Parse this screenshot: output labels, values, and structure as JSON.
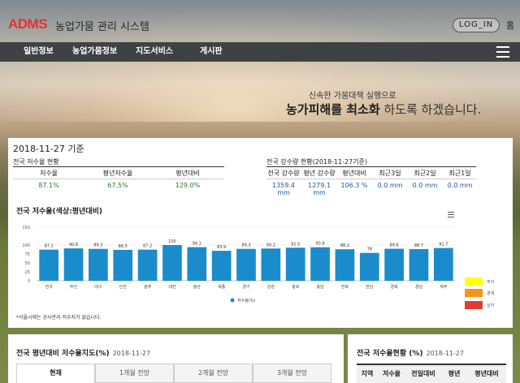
{
  "header": {
    "logo": "ADMS",
    "system_name": "농업가뭄 관리 시스템",
    "login_label": "LOG_IN",
    "home_label": "홈"
  },
  "nav": {
    "items": [
      {
        "label": "일반정보"
      },
      {
        "label": "농업가뭄정보"
      },
      {
        "label": "지도서비스"
      },
      {
        "label": "게시판"
      }
    ]
  },
  "slogan": {
    "line1": "신속한 가뭄대책 실행으로",
    "line2_bold": "농가피해를 최소화",
    "line2_rest": " 하도록 하겠습니다."
  },
  "status": {
    "date_label": "2018-11-27 기준",
    "reservoir": {
      "title": "전국 저수율 현황",
      "headers": [
        "저수율",
        "평년저수율",
        "평년대비"
      ],
      "values": [
        "87.1%",
        "67.5%",
        "129.0%"
      ]
    },
    "rainfall": {
      "title": "전국 강수량 현황(2018-11-27기준)",
      "headers": [
        "전국 강수량",
        "평년 강수량",
        "평년대비",
        "최근3일",
        "최근2일",
        "최근1일"
      ],
      "values": [
        "1359.4 mm",
        "1279.1 mm",
        "106.3 %",
        "0.0 mm",
        "0.0 mm",
        "0.0 mm"
      ]
    }
  },
  "chart_section": {
    "title": "전국 저수율(색상:평년대비)",
    "footnote": "*서울시에는 공사관리 저수지가 없습니다.",
    "status_legend": [
      {
        "label": "주의",
        "color": "#ffff1a"
      },
      {
        "label": "경계",
        "color": "#f7941d"
      },
      {
        "label": "심각",
        "color": "#e03c31"
      }
    ]
  },
  "chart_data": {
    "type": "bar",
    "categories": [
      "전국",
      "부산",
      "대구",
      "인천",
      "광주",
      "대전",
      "울산",
      "세종",
      "경기",
      "강원",
      "충북",
      "충남",
      "전북",
      "전남",
      "경북",
      "경남",
      "제주"
    ],
    "series": [
      {
        "name": "저수율(%)",
        "values": [
          87.1,
          90.6,
          89.3,
          86.5,
          87.2,
          100,
          94.1,
          83.9,
          89.3,
          90.2,
          92.5,
          93.8,
          88.2,
          78,
          89.6,
          88.7,
          91.7
        ],
        "color": "#1a8ccc"
      }
    ],
    "data_labels": [
      "87.1",
      "90.6",
      "89.3",
      "86.5",
      "87.2",
      "100",
      "94.1",
      "83.9",
      "89.3",
      "90.2",
      "92.5",
      "93.8",
      "88.2",
      "78",
      "89.6",
      "88.7",
      "91.7"
    ],
    "y_ticks": [
      "0",
      "25",
      "50",
      "75",
      "100",
      "150"
    ],
    "legend_position": "bottom",
    "grid": true
  },
  "map_section": {
    "title": "전국 평년대비 저수율지도(%)",
    "date": "2018-11-27",
    "tabs": [
      "현재",
      "1개월 전망",
      "2개월 전망",
      "3개월 전망"
    ]
  },
  "table_section": {
    "title": "전국 저수율현황 (%)",
    "date": "2018-11-27",
    "headers": [
      "지역",
      "저수율",
      "전일대비",
      "평년",
      "평년대비"
    ]
  }
}
